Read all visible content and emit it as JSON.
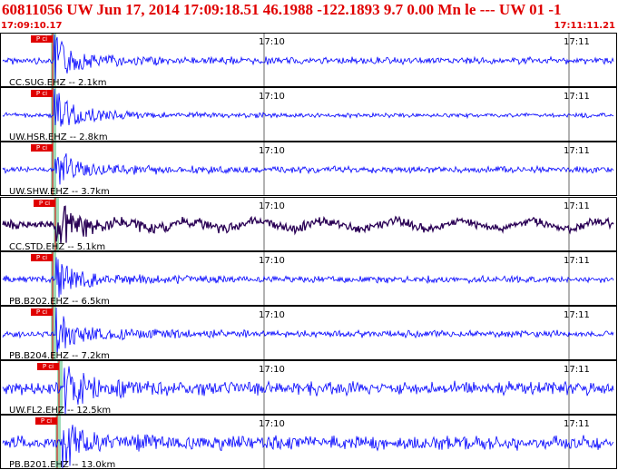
{
  "header": {
    "title": "60811056 UW Jun 17, 2014 17:09:18.51   46.1988 -122.1893  9.7 0.00 Mn le --- UW 01  -1",
    "start_time": "17:09:10.17",
    "end_time": "17:11:11.21"
  },
  "time_marks": [
    "17:10",
    "17:11"
  ],
  "colors": {
    "header": "#e00000",
    "trace": "#0000ff",
    "trace_alt": "#2a0055",
    "pick": "#e00000",
    "band": "#7fd0a0"
  },
  "traces": [
    {
      "label": "CC.SUG.EHZ -- 2.1km",
      "pick": "P ci",
      "amp": 3,
      "color": "#0000ff"
    },
    {
      "label": "UW.HSR.EHZ -- 2.8km",
      "pick": "P ci",
      "amp": 2,
      "color": "#0000ff"
    },
    {
      "label": "UW.SHW.EHZ -- 3.7km",
      "pick": "P ci",
      "amp": 3,
      "color": "#0000ff"
    },
    {
      "label": "CC.STD.EHZ -- 5.1km",
      "pick": "P ci",
      "amp": 4,
      "color": "#2a0055"
    },
    {
      "label": "PB.B202.EHZ -- 6.5km",
      "pick": "P ci",
      "amp": 3,
      "color": "#0000ff"
    },
    {
      "label": "PB.B204.EHZ -- 7.2km",
      "pick": "P ci",
      "amp": 3,
      "color": "#0000ff"
    },
    {
      "label": "UW.FL2.EHZ -- 12.5km",
      "pick": "P ci",
      "amp": 6,
      "color": "#0000ff"
    },
    {
      "label": "PB.B201.EHZ -- 13.0km",
      "pick": "P ci",
      "amp": 6,
      "color": "#0000ff"
    }
  ]
}
